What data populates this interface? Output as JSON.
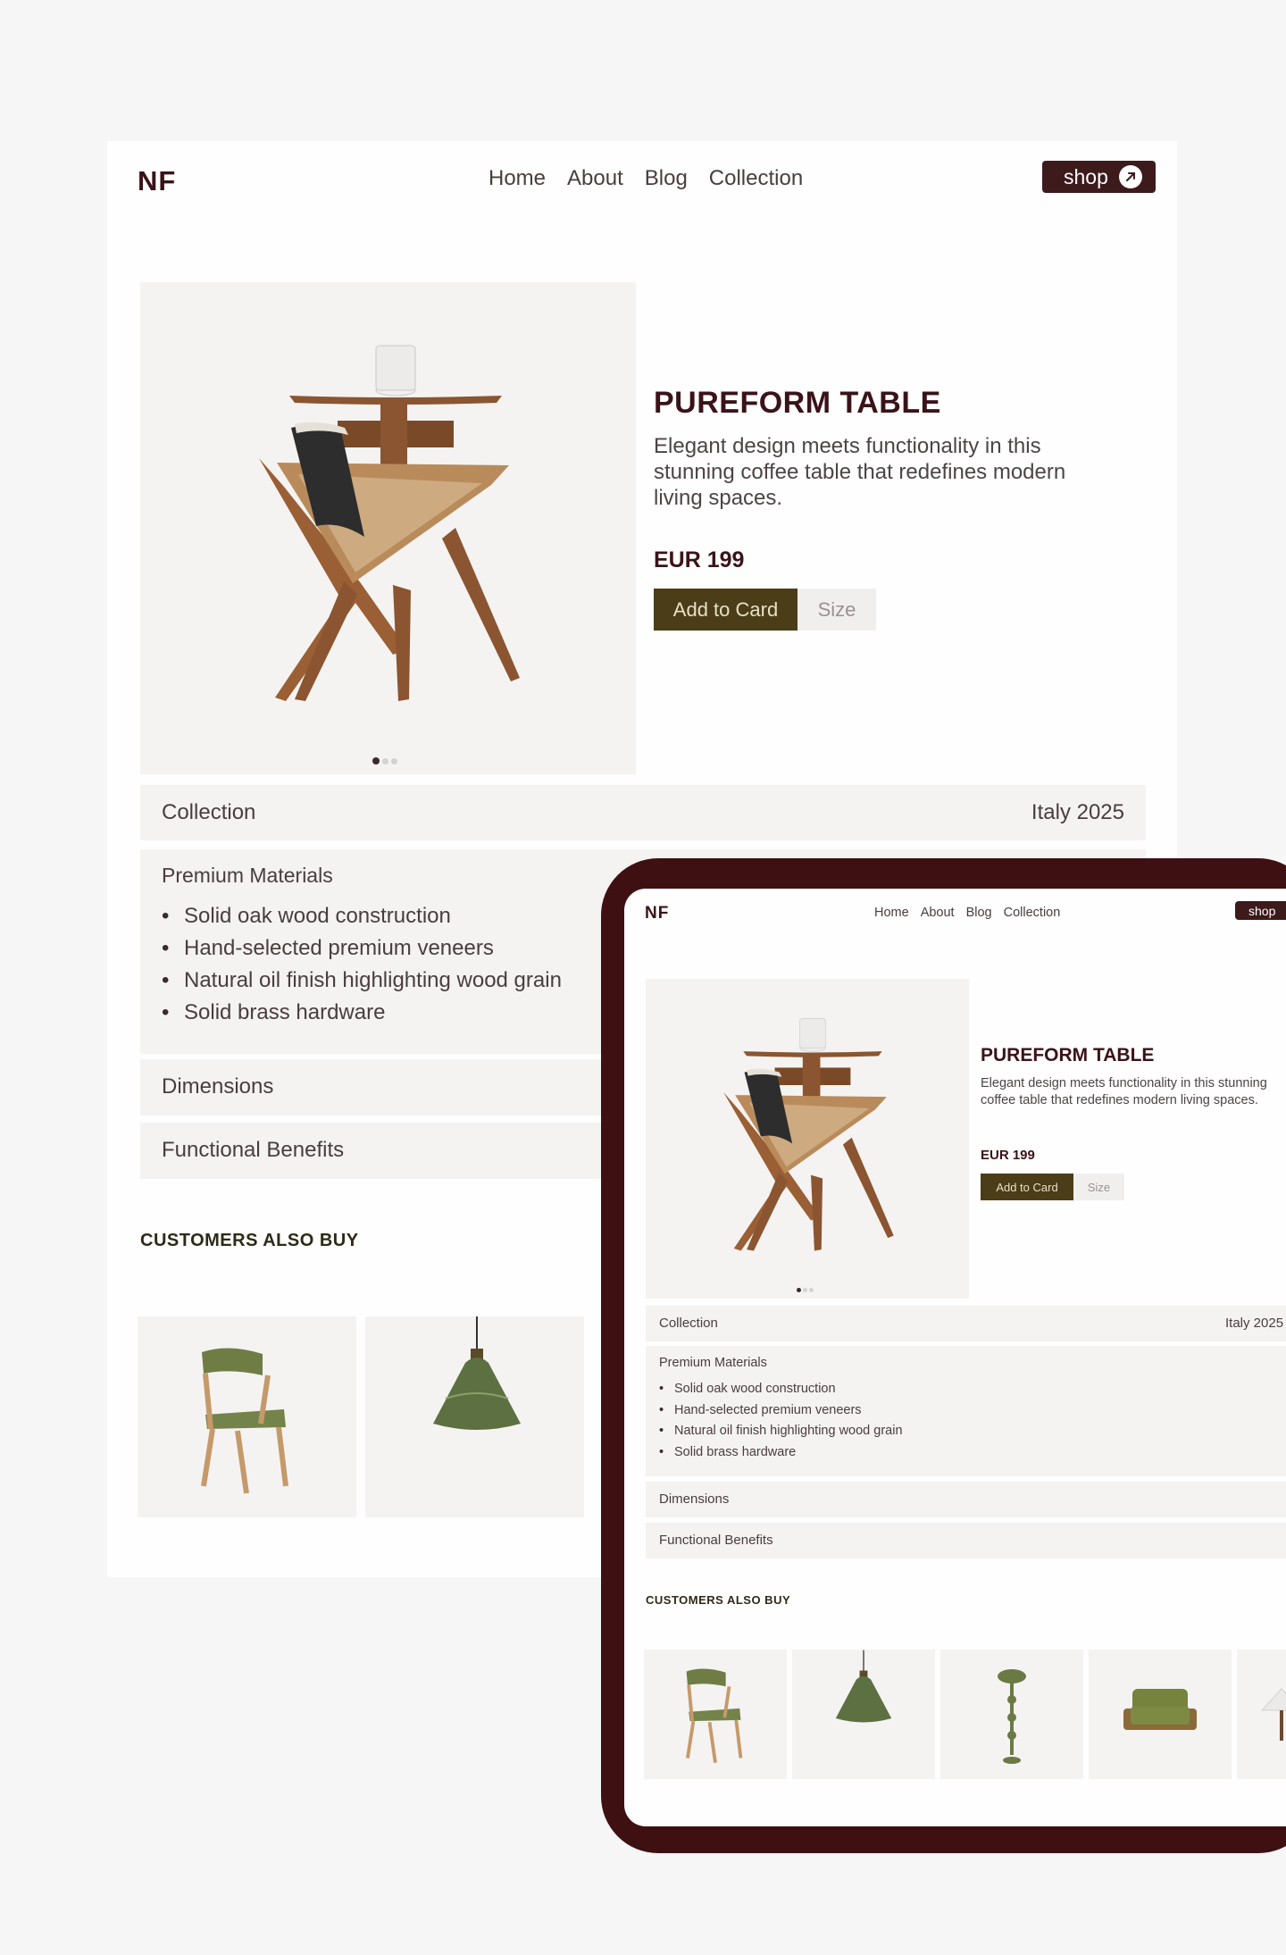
{
  "brand": {
    "logo": "NF"
  },
  "nav": {
    "home": "Home",
    "about": "About",
    "blog": "Blog",
    "collection": "Collection"
  },
  "shop": {
    "label": "shop",
    "icon": "arrow-up-right-icon"
  },
  "product": {
    "title": "PUREFORM TABLE",
    "description": "Elegant design meets functionality in this stunning coffee table that redefines modern living spaces.",
    "price": "EUR 199",
    "add_label": "Add to Card",
    "size_label": "Size",
    "image": "side-table-with-magazine-rack",
    "carousel": {
      "count": 3,
      "active": 1
    }
  },
  "details": {
    "collection_label": "Collection",
    "collection_value": "Italy 2025",
    "materials_label": "Premium Materials",
    "materials": [
      "Solid oak wood construction",
      "Hand-selected premium veneers",
      "Natural oil finish highlighting wood grain",
      "Solid brass hardware"
    ],
    "dimensions_label": "Dimensions",
    "benefits_label": "Functional Benefits"
  },
  "also_buy": {
    "title": "CUSTOMERS ALSO BUY",
    "items": [
      "green-upholstered-chair",
      "green-glass-pendant-lamp",
      "green-floor-lamp",
      "olive-lounge-armchair",
      "white-table-lamp"
    ]
  },
  "colors": {
    "brand_dark": "#3d1a1c",
    "accent_olive": "#4a3d17",
    "panel": "#f4f3f2",
    "tablet_frame": "#3e1012",
    "page_bg": "#f6f6f6"
  }
}
